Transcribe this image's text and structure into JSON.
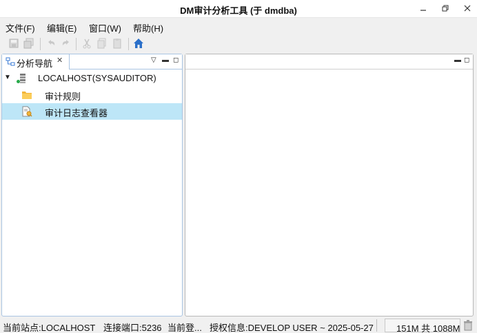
{
  "window": {
    "title": "DM审计分析工具 (于 dmdba)"
  },
  "menu": {
    "items": [
      "文件(F)",
      "编辑(E)",
      "窗口(W)",
      "帮助(H)"
    ]
  },
  "toolbar": {
    "icons": [
      "save-icon",
      "save-all-icon",
      "undo-icon",
      "redo-icon",
      "cut-icon",
      "copy-icon",
      "paste-icon",
      "home-icon"
    ]
  },
  "left_panel": {
    "tab_label": "分析导航",
    "tree": {
      "root_label": "LOCALHOST(SYSAUDITOR)",
      "children": [
        {
          "label": "审计规则",
          "icon": "folder-icon",
          "selected": false
        },
        {
          "label": "审计日志查看器",
          "icon": "log-viewer-icon",
          "selected": true
        }
      ]
    }
  },
  "status": {
    "site": "当前站点:LOCALHOST",
    "port": "连接端口:5236",
    "login": "当前登...",
    "license": "授权信息:DEVELOP USER ~ 2025-05-27",
    "heap": "151M 共 1088M"
  },
  "colors": {
    "selection": "#bde6f7",
    "panel_border": "#a9c4e2",
    "home_icon": "#2a6fc9",
    "folder_icon": "#f2b53a"
  }
}
